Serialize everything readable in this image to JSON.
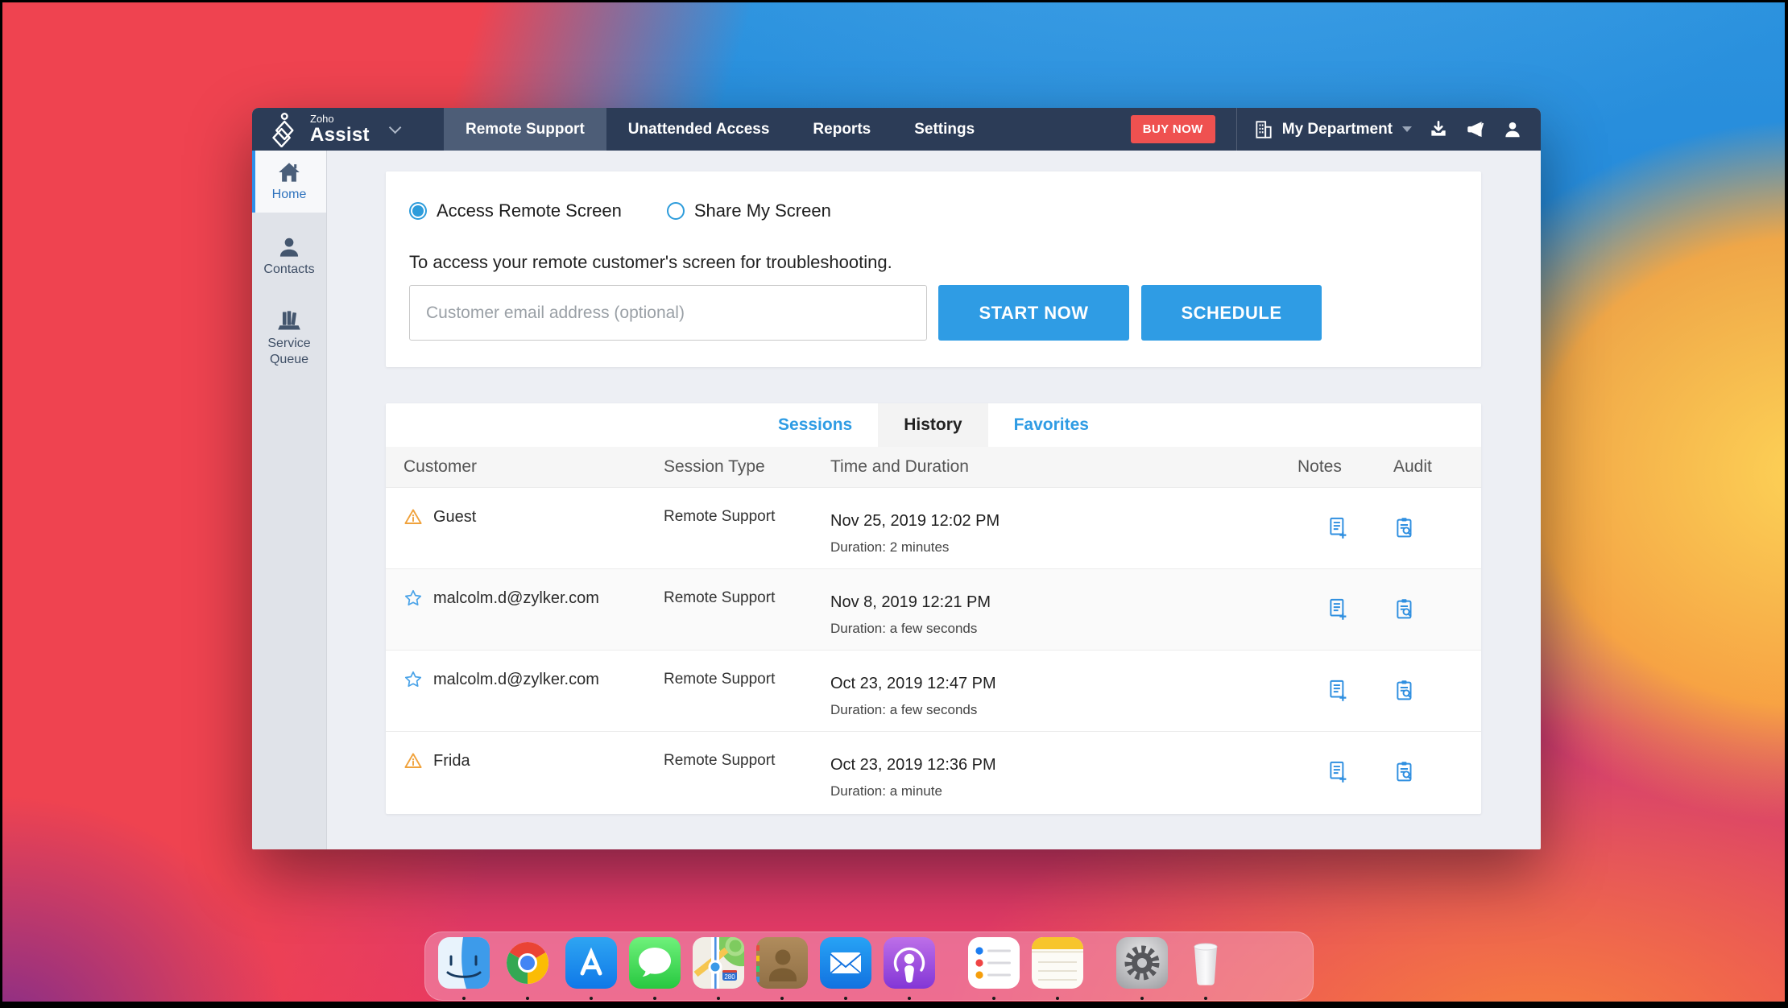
{
  "app": {
    "name_small": "Zoho",
    "name_big": "Assist"
  },
  "navbar": {
    "tabs": [
      {
        "label": "Remote Support",
        "active": true
      },
      {
        "label": "Unattended Access",
        "active": false
      },
      {
        "label": "Reports",
        "active": false
      },
      {
        "label": "Settings",
        "active": false
      }
    ],
    "buy_now": "BUY NOW",
    "department": "My Department"
  },
  "sidebar": {
    "items": [
      {
        "label": "Home",
        "active": true
      },
      {
        "label": "Contacts",
        "active": false
      },
      {
        "label": "Service Queue",
        "active": false
      }
    ]
  },
  "session_panel": {
    "radio_access": "Access Remote Screen",
    "radio_share": "Share My Screen",
    "selected_radio": "Access Remote Screen",
    "subtitle": "To access your remote customer's screen for troubleshooting.",
    "email_placeholder": "Customer email address (optional)",
    "email_value": "",
    "start_button": "START NOW",
    "schedule_button": "SCHEDULE"
  },
  "history_panel": {
    "tabs": [
      {
        "label": "Sessions",
        "active": false
      },
      {
        "label": "History",
        "active": true
      },
      {
        "label": "Favorites",
        "active": false
      }
    ],
    "columns": [
      "Customer",
      "Session Type",
      "Time and Duration",
      "Notes",
      "Audit"
    ],
    "rows": [
      {
        "icon": "warning",
        "customer": "Guest",
        "session_type": "Remote Support",
        "time": "Nov 25, 2019 12:02 PM",
        "duration": "Duration: 2 minutes"
      },
      {
        "icon": "star",
        "customer": "malcolm.d@zylker.com",
        "session_type": "Remote Support",
        "time": "Nov 8, 2019 12:21 PM",
        "duration": "Duration: a few seconds"
      },
      {
        "icon": "star",
        "customer": "malcolm.d@zylker.com",
        "session_type": "Remote Support",
        "time": "Oct 23, 2019 12:47 PM",
        "duration": "Duration: a few seconds"
      },
      {
        "icon": "warning",
        "customer": "Frida",
        "session_type": "Remote Support",
        "time": "Oct 23, 2019 12:36 PM",
        "duration": "Duration: a minute"
      }
    ]
  },
  "dock": {
    "apps": [
      "Finder",
      "Google Chrome",
      "App Store",
      "Messages",
      "Maps",
      "Contacts",
      "Mail",
      "Podcasts",
      "Reminders",
      "Notes",
      "System Preferences",
      "Trash"
    ]
  },
  "colors": {
    "accent_blue": "#2f9ce4",
    "nav_bg": "#2c3c57",
    "nav_active_bg": "#4d5d77",
    "buy_now_red": "#ef5150",
    "warning_orange": "#f0a23c",
    "sidebar_bg": "#e0e3e9"
  }
}
